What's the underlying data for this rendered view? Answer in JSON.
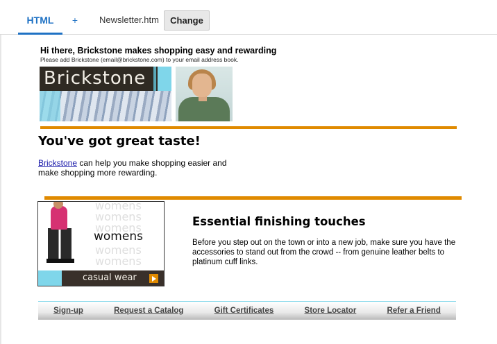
{
  "tabs": {
    "html_label": "HTML",
    "add_label": "+",
    "file_label": "Newsletter.htm",
    "change_label": "Change"
  },
  "email": {
    "greeting": "Hi there, Brickstone makes shopping easy and rewarding",
    "addbook_note": "Please add Brickstone (email@brickstone.com) to your email address book.",
    "logo_text": "Brickstone",
    "headline": "You've got great taste!",
    "help_link": "Brickstone",
    "help_text": " can help you make shopping easier and make shopping more rewarding.",
    "womens_word": "womens",
    "womens_ghost": [
      "womens",
      "womens",
      "womens",
      "womens",
      "womens"
    ],
    "casual_label": "casual wear",
    "finishing_title": "Essential finishing touches",
    "finishing_body": "Before you step out on the town or into a new job, make sure you have the accessories to stand out from the crowd -- from genuine leather belts to platinum cuff links.",
    "footer_links": [
      "Sign-up",
      "Request a Catalog",
      "Gift Certificates",
      "Store Locator",
      "Refer a Friend"
    ]
  },
  "colors": {
    "accent_tab": "#1f72c4",
    "rule_orange": "#e08a00",
    "brand_cyan": "#7fd6ea",
    "brand_dark": "#2f2a23"
  }
}
